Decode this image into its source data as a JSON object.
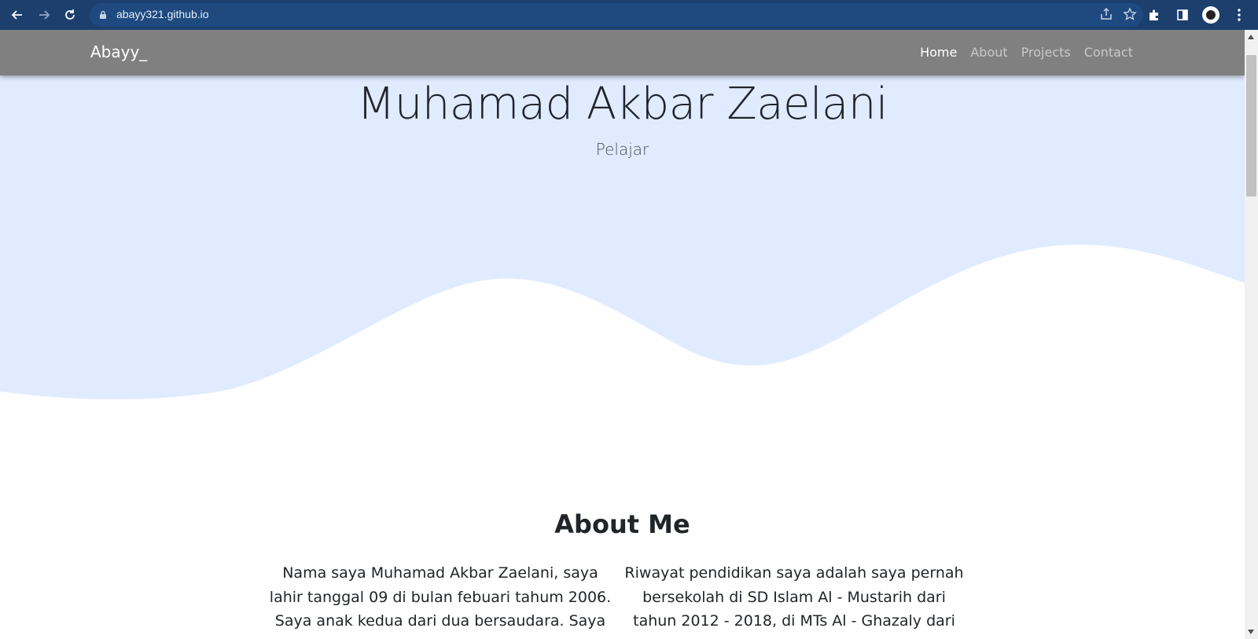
{
  "browser": {
    "url": "abayy321.github.io"
  },
  "navbar": {
    "brand": "Abayy_",
    "links": [
      {
        "label": "Home",
        "active": true
      },
      {
        "label": "About",
        "active": false
      },
      {
        "label": "Projects",
        "active": false
      },
      {
        "label": "Contact",
        "active": false
      }
    ]
  },
  "hero": {
    "name": "Muhamad Akbar Zaelani",
    "role": "Pelajar",
    "background_color": "#e0ebff"
  },
  "about": {
    "title": "About Me",
    "left_text": "Nama saya Muhamad Akbar Zaelani, saya lahir tanggal 09 di bulan febuari tahum 2006. Saya anak kedua dari dua bersaudara. Saya tinggal",
    "right_text": "Riwayat pendidikan saya adalah saya pernah bersekolah di SD Islam Al - Mustarih dari tahun 2012 - 2018, di MTs Al - Ghazaly dari tahun"
  }
}
